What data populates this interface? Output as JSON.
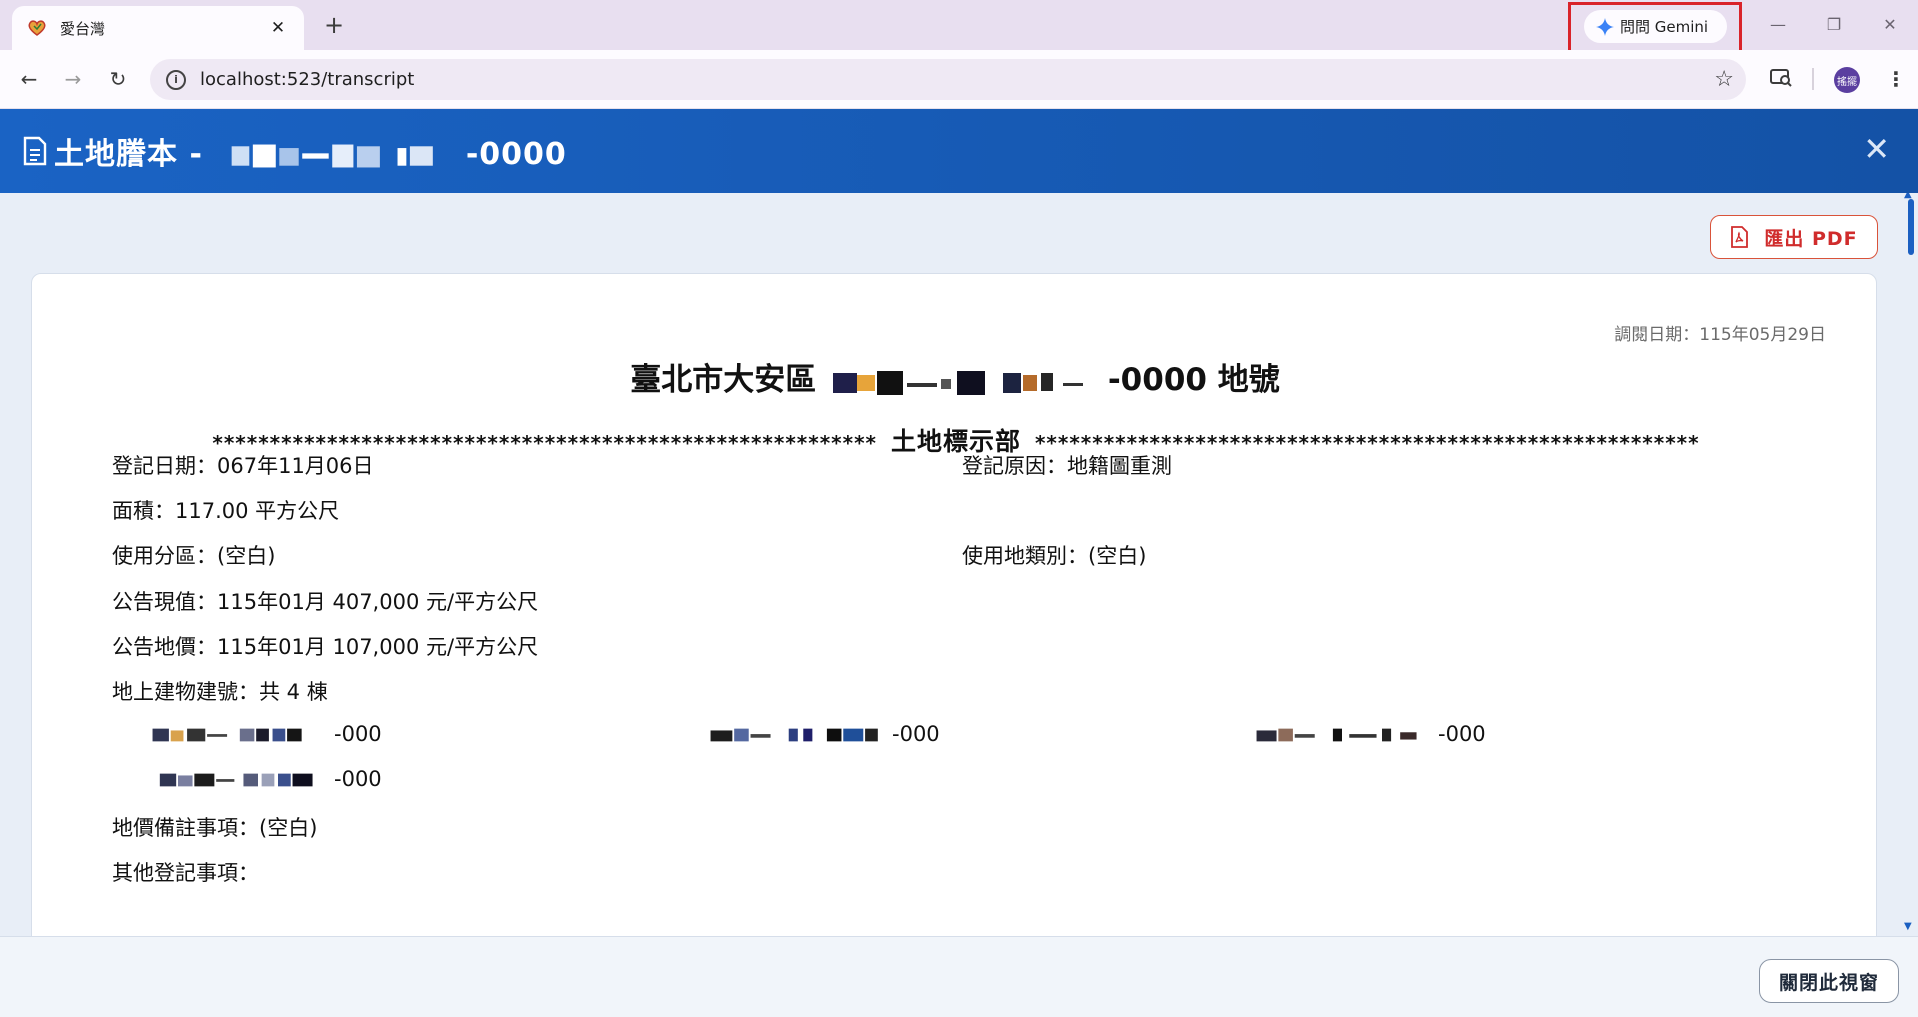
{
  "browser": {
    "tab_title": "愛台灣",
    "new_tab": "+",
    "url": "localhost:523/transcript",
    "gemini_label": "問問 Gemini",
    "profile_initial": "搖擺"
  },
  "modal": {
    "title_prefix": "土地謄本 -",
    "title_suffix": "-0000",
    "export_label": "匯出 PDF",
    "close_window_label": "關閉此視窗"
  },
  "transcript": {
    "query_date": "調閱日期：115年05月29日",
    "heading_prefix": "臺北市大安區",
    "heading_suffix": "-0000 地號",
    "section_stars_left": "**********************************************************",
    "section_title": "土地標示部",
    "section_stars_right": "**********************************************************",
    "registration_date": "登記日期：067年11月06日",
    "registration_reason": "登記原因：地籍圖重測",
    "area": "面積：117.00 平方公尺",
    "zoning": "使用分區：(空白)",
    "land_use_category": "使用地類別：(空白)",
    "announced_current_value": "公告現值：115年01月 407,000 元/平方公尺",
    "announced_land_price": "公告地價：115年01月 107,000 元/平方公尺",
    "buildings_label": "地上建物建號：共 4 棟",
    "building_numbers": [
      "-000",
      "-000",
      "-000",
      "-000"
    ],
    "land_price_notes": "地價備註事項：(空白)",
    "other_registration": "其他登記事項："
  },
  "colors": {
    "header_blue": "#1a63c4",
    "export_red": "#d02c2c",
    "gemini_highlight": "#d9232a"
  }
}
